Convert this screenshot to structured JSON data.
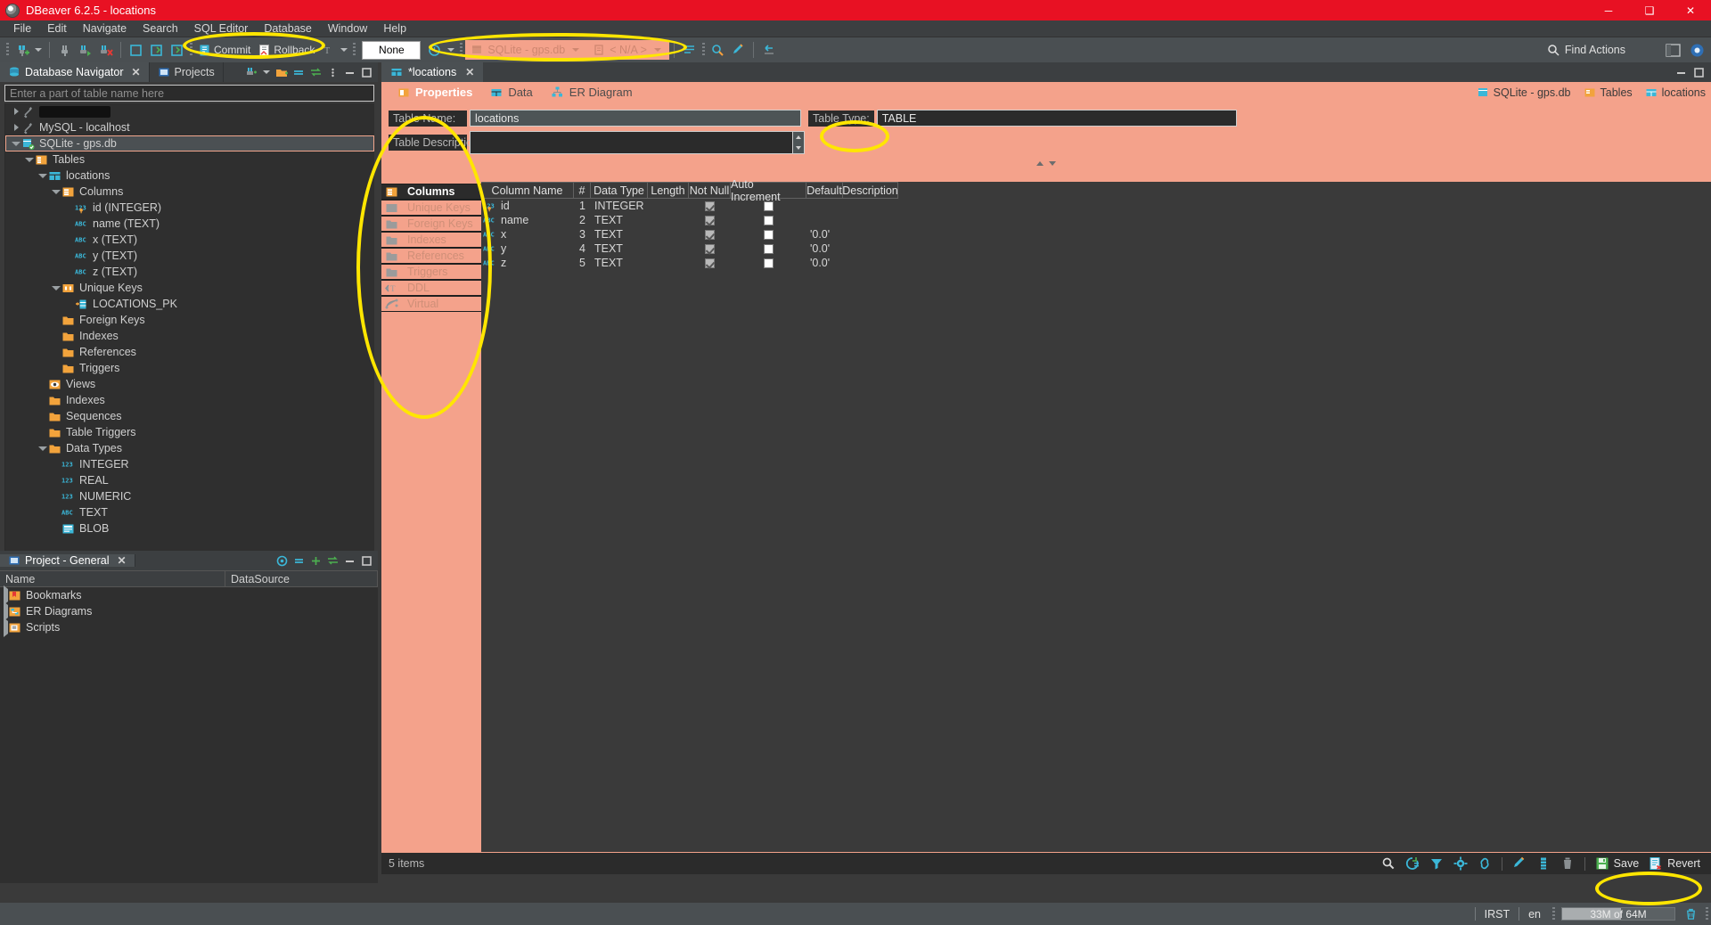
{
  "window": {
    "title": "DBeaver 6.2.5 - locations",
    "app_icon": "dbeaver-icon",
    "minimize_label": "─",
    "maximize_label": "❑",
    "close_label": "✕"
  },
  "menubar": {
    "items": [
      "File",
      "Edit",
      "Navigate",
      "Search",
      "SQL Editor",
      "Database",
      "Window",
      "Help"
    ]
  },
  "toolbar": {
    "commit_label": "Commit",
    "rollback_label": "Rollback",
    "transaction_mode": "None",
    "connection_label": "SQLite - gps.db",
    "schema_label": "< N/A >",
    "find_actions_label": "Find Actions"
  },
  "navigator": {
    "tabs": [
      {
        "label": "Database Navigator",
        "active": true,
        "icon": "database-navigator-icon",
        "closable": true
      },
      {
        "label": "Projects",
        "active": false,
        "icon": "projects-icon",
        "closable": false
      }
    ],
    "filter_placeholder": "Enter a part of table name here",
    "tree": [
      {
        "label": "",
        "indent": 0,
        "twisty": "collapsed",
        "icon": "connection-icon",
        "redacted": true
      },
      {
        "label": "MySQL - localhost",
        "indent": 0,
        "twisty": "collapsed",
        "icon": "connection-icon"
      },
      {
        "label": "SQLite - gps.db",
        "indent": 0,
        "twisty": "expanded",
        "icon": "sqlite-icon",
        "selected": true
      },
      {
        "label": "Tables",
        "indent": 1,
        "twisty": "expanded",
        "icon": "tables-folder-icon"
      },
      {
        "label": "locations",
        "indent": 2,
        "twisty": "expanded",
        "icon": "table-icon"
      },
      {
        "label": "Columns",
        "indent": 3,
        "twisty": "expanded",
        "icon": "columns-folder-icon"
      },
      {
        "label": "id (INTEGER)",
        "indent": 4,
        "twisty": "none",
        "icon": "integer-key-icon"
      },
      {
        "label": "name (TEXT)",
        "indent": 4,
        "twisty": "none",
        "icon": "abc-icon"
      },
      {
        "label": "x (TEXT)",
        "indent": 4,
        "twisty": "none",
        "icon": "abc-icon"
      },
      {
        "label": "y (TEXT)",
        "indent": 4,
        "twisty": "none",
        "icon": "abc-icon"
      },
      {
        "label": "z (TEXT)",
        "indent": 4,
        "twisty": "none",
        "icon": "abc-icon"
      },
      {
        "label": "Unique Keys",
        "indent": 3,
        "twisty": "expanded",
        "icon": "unique-keys-icon"
      },
      {
        "label": "LOCATIONS_PK",
        "indent": 4,
        "twisty": "none",
        "icon": "primary-key-icon"
      },
      {
        "label": "Foreign Keys",
        "indent": 3,
        "twisty": "none",
        "icon": "folder-icon"
      },
      {
        "label": "Indexes",
        "indent": 3,
        "twisty": "none",
        "icon": "folder-icon"
      },
      {
        "label": "References",
        "indent": 3,
        "twisty": "none",
        "icon": "folder-icon"
      },
      {
        "label": "Triggers",
        "indent": 3,
        "twisty": "none",
        "icon": "folder-icon"
      },
      {
        "label": "Views",
        "indent": 2,
        "twisty": "none",
        "icon": "views-icon"
      },
      {
        "label": "Indexes",
        "indent": 2,
        "twisty": "none",
        "icon": "folder-icon"
      },
      {
        "label": "Sequences",
        "indent": 2,
        "twisty": "none",
        "icon": "folder-icon"
      },
      {
        "label": "Table Triggers",
        "indent": 2,
        "twisty": "none",
        "icon": "folder-icon"
      },
      {
        "label": "Data Types",
        "indent": 2,
        "twisty": "expanded",
        "icon": "folder-icon"
      },
      {
        "label": "INTEGER",
        "indent": 3,
        "twisty": "none",
        "icon": "number-type-icon"
      },
      {
        "label": "REAL",
        "indent": 3,
        "twisty": "none",
        "icon": "number-type-icon"
      },
      {
        "label": "NUMERIC",
        "indent": 3,
        "twisty": "none",
        "icon": "number-type-icon"
      },
      {
        "label": "TEXT",
        "indent": 3,
        "twisty": "none",
        "icon": "abc-icon"
      },
      {
        "label": "BLOB",
        "indent": 3,
        "twisty": "none",
        "icon": "blob-icon"
      }
    ]
  },
  "project_panel": {
    "tab_label": "Project - General",
    "columns": [
      "Name",
      "DataSource"
    ],
    "rows": [
      {
        "name": "Bookmarks",
        "icon": "bookmarks-icon",
        "datasource": ""
      },
      {
        "name": "ER Diagrams",
        "icon": "er-diagram-icon",
        "datasource": ""
      },
      {
        "name": "Scripts",
        "icon": "scripts-icon",
        "datasource": ""
      }
    ]
  },
  "editor": {
    "tab_label": "*locations",
    "tab_icon": "table-icon",
    "inner_tabs": [
      {
        "label": "Properties",
        "icon": "properties-icon",
        "active": true
      },
      {
        "label": "Data",
        "icon": "data-grid-icon",
        "active": false
      },
      {
        "label": "ER Diagram",
        "icon": "er-diagram-icon",
        "active": false
      }
    ],
    "breadcrumb": [
      {
        "label": "SQLite - gps.db",
        "icon": "sqlite-icon"
      },
      {
        "label": "Tables",
        "icon": "tables-folder-icon"
      },
      {
        "label": "locations",
        "icon": "table-icon"
      }
    ],
    "form": {
      "table_name_label": "Table Name:",
      "table_name_value": "locations",
      "table_description_label": "Table Description:",
      "table_description_value": "",
      "table_type_label": "Table Type:",
      "table_type_value": "TABLE"
    },
    "side_tabs": [
      {
        "label": "Columns",
        "active": true,
        "icon": "columns-folder-icon"
      },
      {
        "label": "Unique Keys",
        "active": false,
        "icon": "unique-keys-icon"
      },
      {
        "label": "Foreign Keys",
        "active": false,
        "icon": "folder-icon"
      },
      {
        "label": "Indexes",
        "active": false,
        "icon": "folder-icon"
      },
      {
        "label": "References",
        "active": false,
        "icon": "folder-icon"
      },
      {
        "label": "Triggers",
        "active": false,
        "icon": "folder-icon"
      },
      {
        "label": "DDL",
        "active": false,
        "icon": "ddl-icon"
      },
      {
        "label": "Virtual",
        "active": false,
        "icon": "virtual-icon"
      }
    ],
    "grid": {
      "columns": [
        "Column Name",
        "#",
        "Data Type",
        "Length",
        "Not Null",
        "Auto Increment",
        "Default",
        "Description"
      ],
      "rows": [
        {
          "icon": "integer-key-icon",
          "name": "id",
          "num": "1",
          "type": "INTEGER",
          "length": "",
          "not_null": true,
          "auto_increment": false,
          "default": "",
          "description": ""
        },
        {
          "icon": "abc-icon",
          "name": "name",
          "num": "2",
          "type": "TEXT",
          "length": "",
          "not_null": true,
          "auto_increment": false,
          "default": "",
          "description": ""
        },
        {
          "icon": "abc-icon",
          "name": "x",
          "num": "3",
          "type": "TEXT",
          "length": "",
          "not_null": true,
          "auto_increment": false,
          "default": "'0.0'",
          "description": ""
        },
        {
          "icon": "abc-icon",
          "name": "y",
          "num": "4",
          "type": "TEXT",
          "length": "",
          "not_null": true,
          "auto_increment": false,
          "default": "'0.0'",
          "description": ""
        },
        {
          "icon": "abc-icon",
          "name": "z",
          "num": "5",
          "type": "TEXT",
          "length": "",
          "not_null": true,
          "auto_increment": false,
          "default": "'0.0'",
          "description": ""
        }
      ]
    },
    "grid_footer": {
      "item_count": "5 items",
      "save_label": "Save",
      "revert_label": "Revert"
    }
  },
  "statusbar": {
    "locale_keyboard": "IRST",
    "language": "en",
    "memory": "33M of 64M",
    "memory_percent": 52
  },
  "colors": {
    "titlebar": "#e81123",
    "accent_panel": "#f4a28b",
    "annotation": "#ffe600",
    "selection": "#4b5053"
  }
}
